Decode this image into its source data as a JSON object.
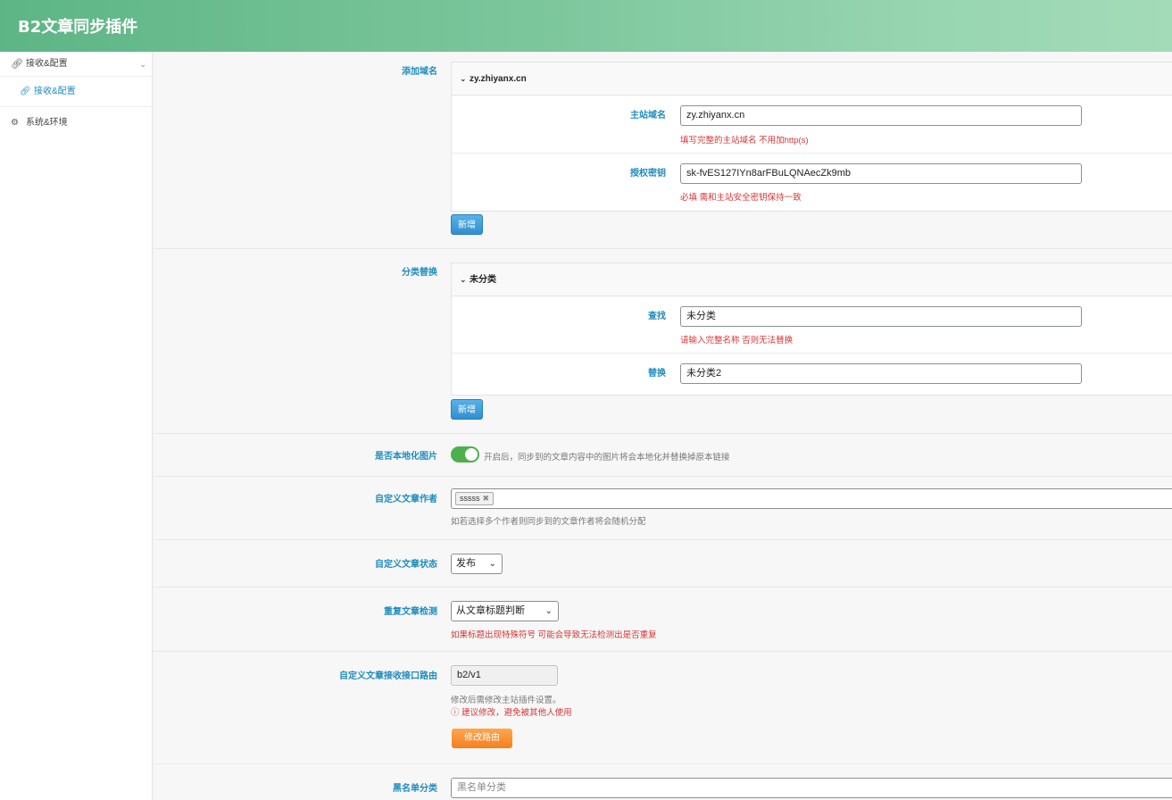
{
  "header": {
    "title": "B2文章同步插件"
  },
  "sidebar": {
    "groups": [
      {
        "label": "接收&配置",
        "sub": "接收&配置"
      },
      {
        "label": "系统&环境"
      }
    ]
  },
  "domains": {
    "label": "添加域名",
    "item_title": "zy.zhiyanx.cn",
    "main_label": "主站域名",
    "main_value": "zy.zhiyanx.cn",
    "main_hint": "填写完整的主站域名 不用加http(s)",
    "key_label": "授权密钥",
    "key_value": "sk-fvES127IYn8arFBuLQNAecZk9mb",
    "key_hint": "必填 需和主站安全密钥保持一致",
    "add_button": "新增"
  },
  "category": {
    "label": "分类替换",
    "item_title": "未分类",
    "find_label": "查找",
    "find_value": "未分类",
    "find_hint": "请输入完整名称 否则无法替换",
    "replace_label": "替换",
    "replace_value": "未分类2",
    "add_button": "新增"
  },
  "localize": {
    "label": "是否本地化图片",
    "enabled": true,
    "desc": "开启后，同步到的文章内容中的图片将会本地化并替换掉原本链接"
  },
  "author": {
    "label": "自定义文章作者",
    "tag": "sssss",
    "desc": "如若选择多个作者则同步到的文章作者将会随机分配"
  },
  "status": {
    "label": "自定义文章状态",
    "value": "发布"
  },
  "duplicate": {
    "label": "重复文章检测",
    "value": "从文章标题判断",
    "hint": "如果标题出现特殊符号 可能会导致无法检测出是否重复"
  },
  "route": {
    "label": "自定义文章接收接口路由",
    "value": "b2/v1",
    "desc": "修改后需修改主站插件设置。",
    "warn": "建议修改，避免被其他人使用",
    "button": "修改路由"
  },
  "blacklist": {
    "label": "黑名单分类",
    "placeholder": "黑名单分类"
  },
  "colors": {
    "accent": "#1e8cbe",
    "error": "#d63638",
    "toggle_on": "#4cb04c",
    "header": "#7cc69c"
  }
}
